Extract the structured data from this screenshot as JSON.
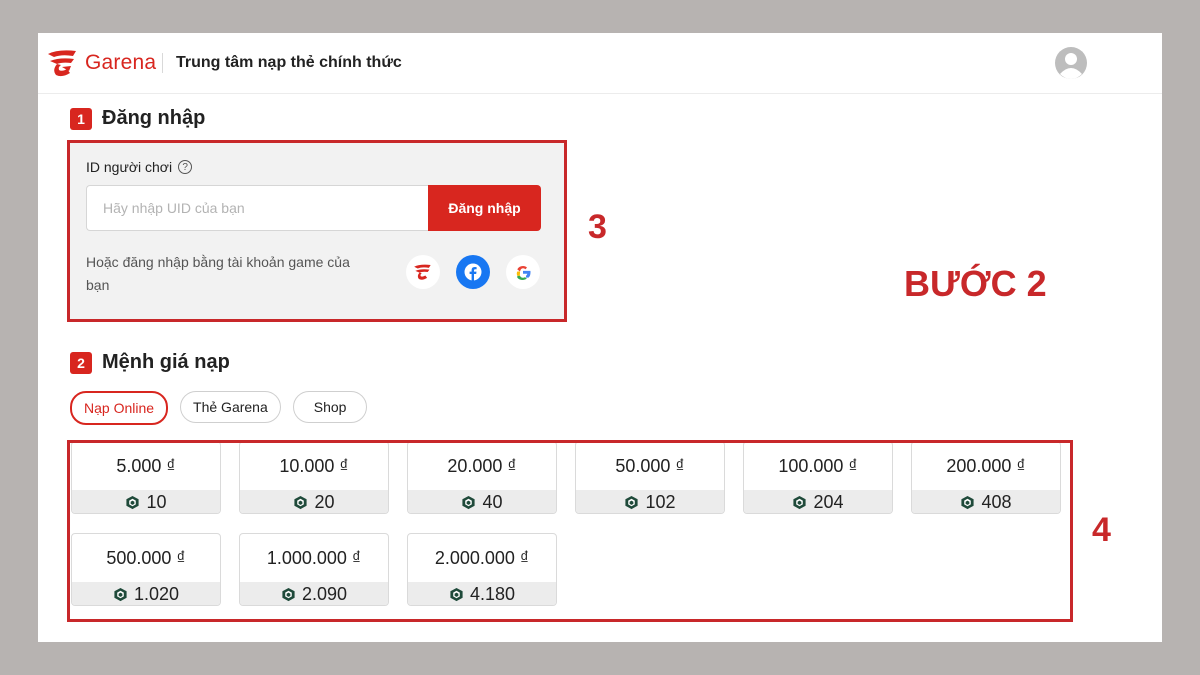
{
  "header": {
    "brand": "Garena",
    "title": "Trung tâm nạp thẻ chính thức"
  },
  "login": {
    "step_number": "1",
    "step_title": "Đăng nhập",
    "id_label": "ID người chơi",
    "help_glyph": "?",
    "input_placeholder": "Hãy nhập UID của bạn",
    "input_value": "",
    "button_label": "Đăng nhập",
    "alt_text": "Hoặc đăng nhập bằng tài khoản game của bạn",
    "social_icons": [
      "garena-icon",
      "facebook-icon",
      "google-icon"
    ]
  },
  "denominations": {
    "step_number": "2",
    "step_title": "Mệnh giá nạp",
    "tabs": [
      {
        "label": "Nạp Online",
        "active": true
      },
      {
        "label": "Thẻ Garena",
        "active": false
      },
      {
        "label": "Shop",
        "active": false
      }
    ],
    "cards": [
      {
        "price": "5.000 ₫",
        "diamonds": "10"
      },
      {
        "price": "10.000 ₫",
        "diamonds": "20"
      },
      {
        "price": "20.000 ₫",
        "diamonds": "40"
      },
      {
        "price": "50.000 ₫",
        "diamonds": "102"
      },
      {
        "price": "100.000 ₫",
        "diamonds": "204"
      },
      {
        "price": "200.000 ₫",
        "diamonds": "408"
      },
      {
        "price": "500.000 ₫",
        "diamonds": "1.020"
      },
      {
        "price": "1.000.000 ₫",
        "diamonds": "2.090"
      },
      {
        "price": "2.000.000 ₫",
        "diamonds": "4.180"
      }
    ]
  },
  "annotations": {
    "login_marker": "3",
    "step_caption": "BƯỚC 2",
    "cards_marker": "4"
  },
  "colors": {
    "brand_red": "#d8261f",
    "annotation_red": "#c8282a",
    "facebook_blue": "#1877f2",
    "background_gray": "#b7b3b1"
  }
}
